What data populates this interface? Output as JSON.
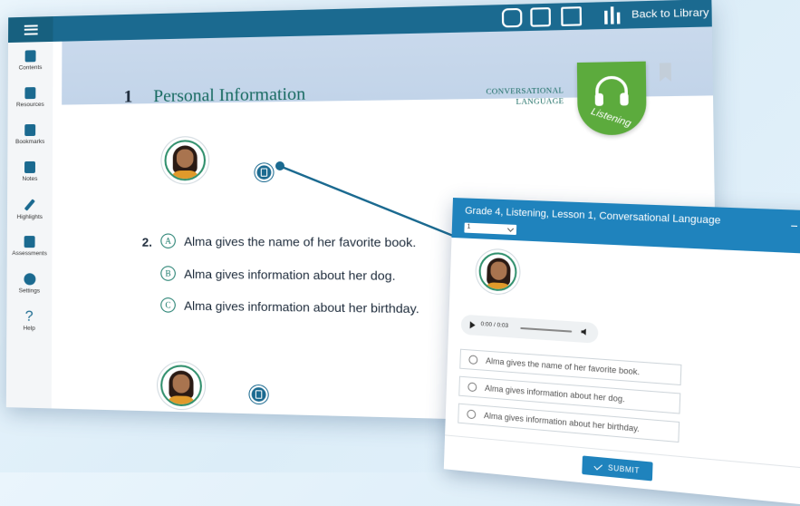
{
  "topbar": {
    "menu_icon": "hamburger-icon",
    "tools": [
      "copy-icon",
      "search-document-icon",
      "notes-add-icon"
    ],
    "library_icon": "library-books-icon",
    "back_to_library": "Back to Library"
  },
  "sidebar": {
    "items": [
      {
        "label": "Contents",
        "icon": "contents-icon"
      },
      {
        "label": "Resources",
        "icon": "resources-icon"
      },
      {
        "label": "Bookmarks",
        "icon": "bookmark-icon"
      },
      {
        "label": "Notes",
        "icon": "notes-icon"
      },
      {
        "label": "Highlights",
        "icon": "pencil-icon"
      },
      {
        "label": "Assessments",
        "icon": "clipboard-icon"
      },
      {
        "label": "Settings",
        "icon": "gear-icon"
      },
      {
        "label": "Help",
        "icon": "question-icon"
      }
    ]
  },
  "lesson": {
    "number": "1",
    "title": "Personal Information",
    "category_line1": "CONVERSATIONAL",
    "category_line2": "LANGUAGE",
    "badge": "Listening"
  },
  "question": {
    "number": "2.",
    "choices": [
      {
        "letter": "A",
        "text": "Alma gives the name of her favorite book."
      },
      {
        "letter": "B",
        "text": "Alma gives information about her dog."
      },
      {
        "letter": "C",
        "text": "Alma gives information about her birthday."
      }
    ]
  },
  "modal": {
    "title": "Grade 4, Listening, Lesson 1, Conversational Language",
    "select_value": "1",
    "audio_time": "0:00 / 0:03",
    "choices": [
      "Alma gives the name of her favorite book.",
      "Alma gives information about her dog.",
      "Alma gives information about her birthday."
    ],
    "submit_label": "SUBMIT"
  },
  "colors": {
    "topbar": "#1b6a90",
    "modal_header": "#1f83bd",
    "listening_badge": "#5cab3d",
    "title_teal": "#176a61",
    "header_band": "#c9d9ec"
  }
}
